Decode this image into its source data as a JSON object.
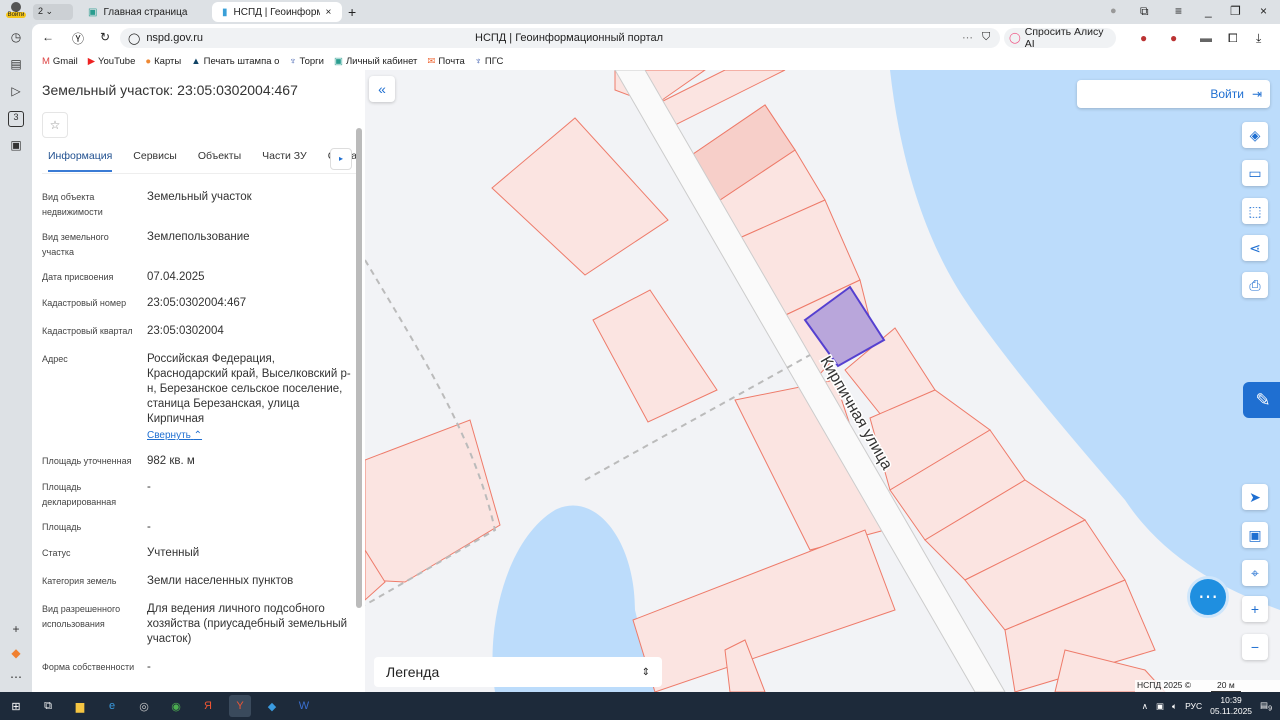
{
  "browser": {
    "login_label": "Войти",
    "tab_count": "2",
    "tabs": [
      {
        "title": "Главная страница"
      },
      {
        "title": "НСПД | Геоинформаци"
      }
    ],
    "url": "nspd.gov.ru",
    "page_title": "НСПД | Геоинформационный портал",
    "alice": "Спросить Алису AI",
    "sidebar_badge": "3",
    "bookmarks": [
      "Gmail",
      "YouTube",
      "Карты",
      "Печать штампа о",
      "Торги",
      "Личный кабинет",
      "Почта",
      "ПГС"
    ]
  },
  "panel": {
    "title": "Земельный участок: 23:05:0302004:467",
    "tabs": [
      "Информация",
      "Сервисы",
      "Объекты",
      "Части ЗУ",
      "Соста"
    ],
    "fields": [
      {
        "label": "Вид объекта недвижимости",
        "value": "Земельный участок"
      },
      {
        "label": "Вид земельного участка",
        "value": "Землепользование"
      },
      {
        "label": "Дата присвоения",
        "value": "07.04.2025"
      },
      {
        "label": "Кадастровый номер",
        "value": "23:05:0302004:467"
      },
      {
        "label": "Кадастровый квартал",
        "value": "23:05:0302004"
      },
      {
        "label": "Адрес",
        "value": "Российская Федерация, Краснодарский край, Выселковский р-н, Березанское сельское поселение, станица Березанская, улица Кирпичная"
      },
      {
        "label": "Площадь уточненная",
        "value": "982 кв. м"
      },
      {
        "label": "Площадь декларированная",
        "value": "-"
      },
      {
        "label": "Площадь",
        "value": "-"
      },
      {
        "label": "Статус",
        "value": "Учтенный"
      },
      {
        "label": "Категория земель",
        "value": "Земли населенных пунктов"
      },
      {
        "label": "Вид разрешенного использования",
        "value": "Для ведения личного подсобного хозяйства (приусадебный земельный участок)"
      },
      {
        "label": "Форма собственности",
        "value": "-"
      }
    ],
    "collapse_link": "Свернуть"
  },
  "map": {
    "login": "Войти",
    "street": "Кирпичная улица",
    "legend": "Легенда",
    "copyright": "НСПД 2025 ©",
    "scale": "20 м"
  },
  "taskbar": {
    "lang": "РУС",
    "time": "10:39",
    "date": "05.11.2025",
    "notif": "9"
  }
}
